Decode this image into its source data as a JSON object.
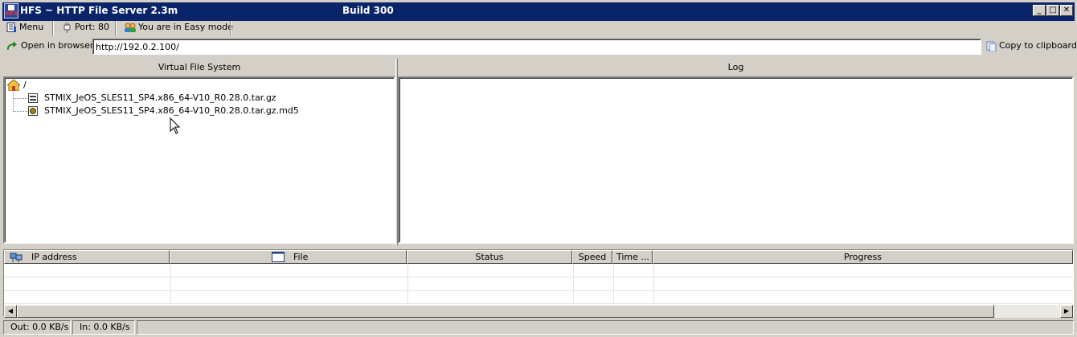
{
  "window": {
    "title": "HFS ~ HTTP File Server 2.3m",
    "build": "Build 300",
    "buttons": {
      "minimize": "_",
      "maximize": "□",
      "close": "✕"
    }
  },
  "toolbar": {
    "menu_label": "Menu",
    "port_label": "Port: 80",
    "mode_label": "You are in Easy mode"
  },
  "urlbar": {
    "open_browser_label": "Open in browser",
    "url": "http://192.0.2.100/",
    "copy_label": "Copy to clipboard"
  },
  "vfs": {
    "header": "Virtual File System",
    "root": "/",
    "files": [
      {
        "name": "STMIX_JeOS_SLES11_SP4.x86_64-V10_R0.28.0.tar.gz",
        "icon": "archive-file-icon"
      },
      {
        "name": "STMIX_JeOS_SLES11_SP4.x86_64-V10_R0.28.0.tar.gz.md5",
        "icon": "md5-file-icon"
      }
    ]
  },
  "log": {
    "header": "Log"
  },
  "connections": {
    "columns": [
      "IP address",
      "File",
      "Status",
      "Speed",
      "Time ...",
      "Progress"
    ]
  },
  "status": {
    "out": "Out: 0.0 KB/s",
    "in": "In: 0.0 KB/s"
  },
  "colors": {
    "titlebar": "#0a246a",
    "face": "#d4d0c8",
    "window_bg": "#ffffff"
  }
}
